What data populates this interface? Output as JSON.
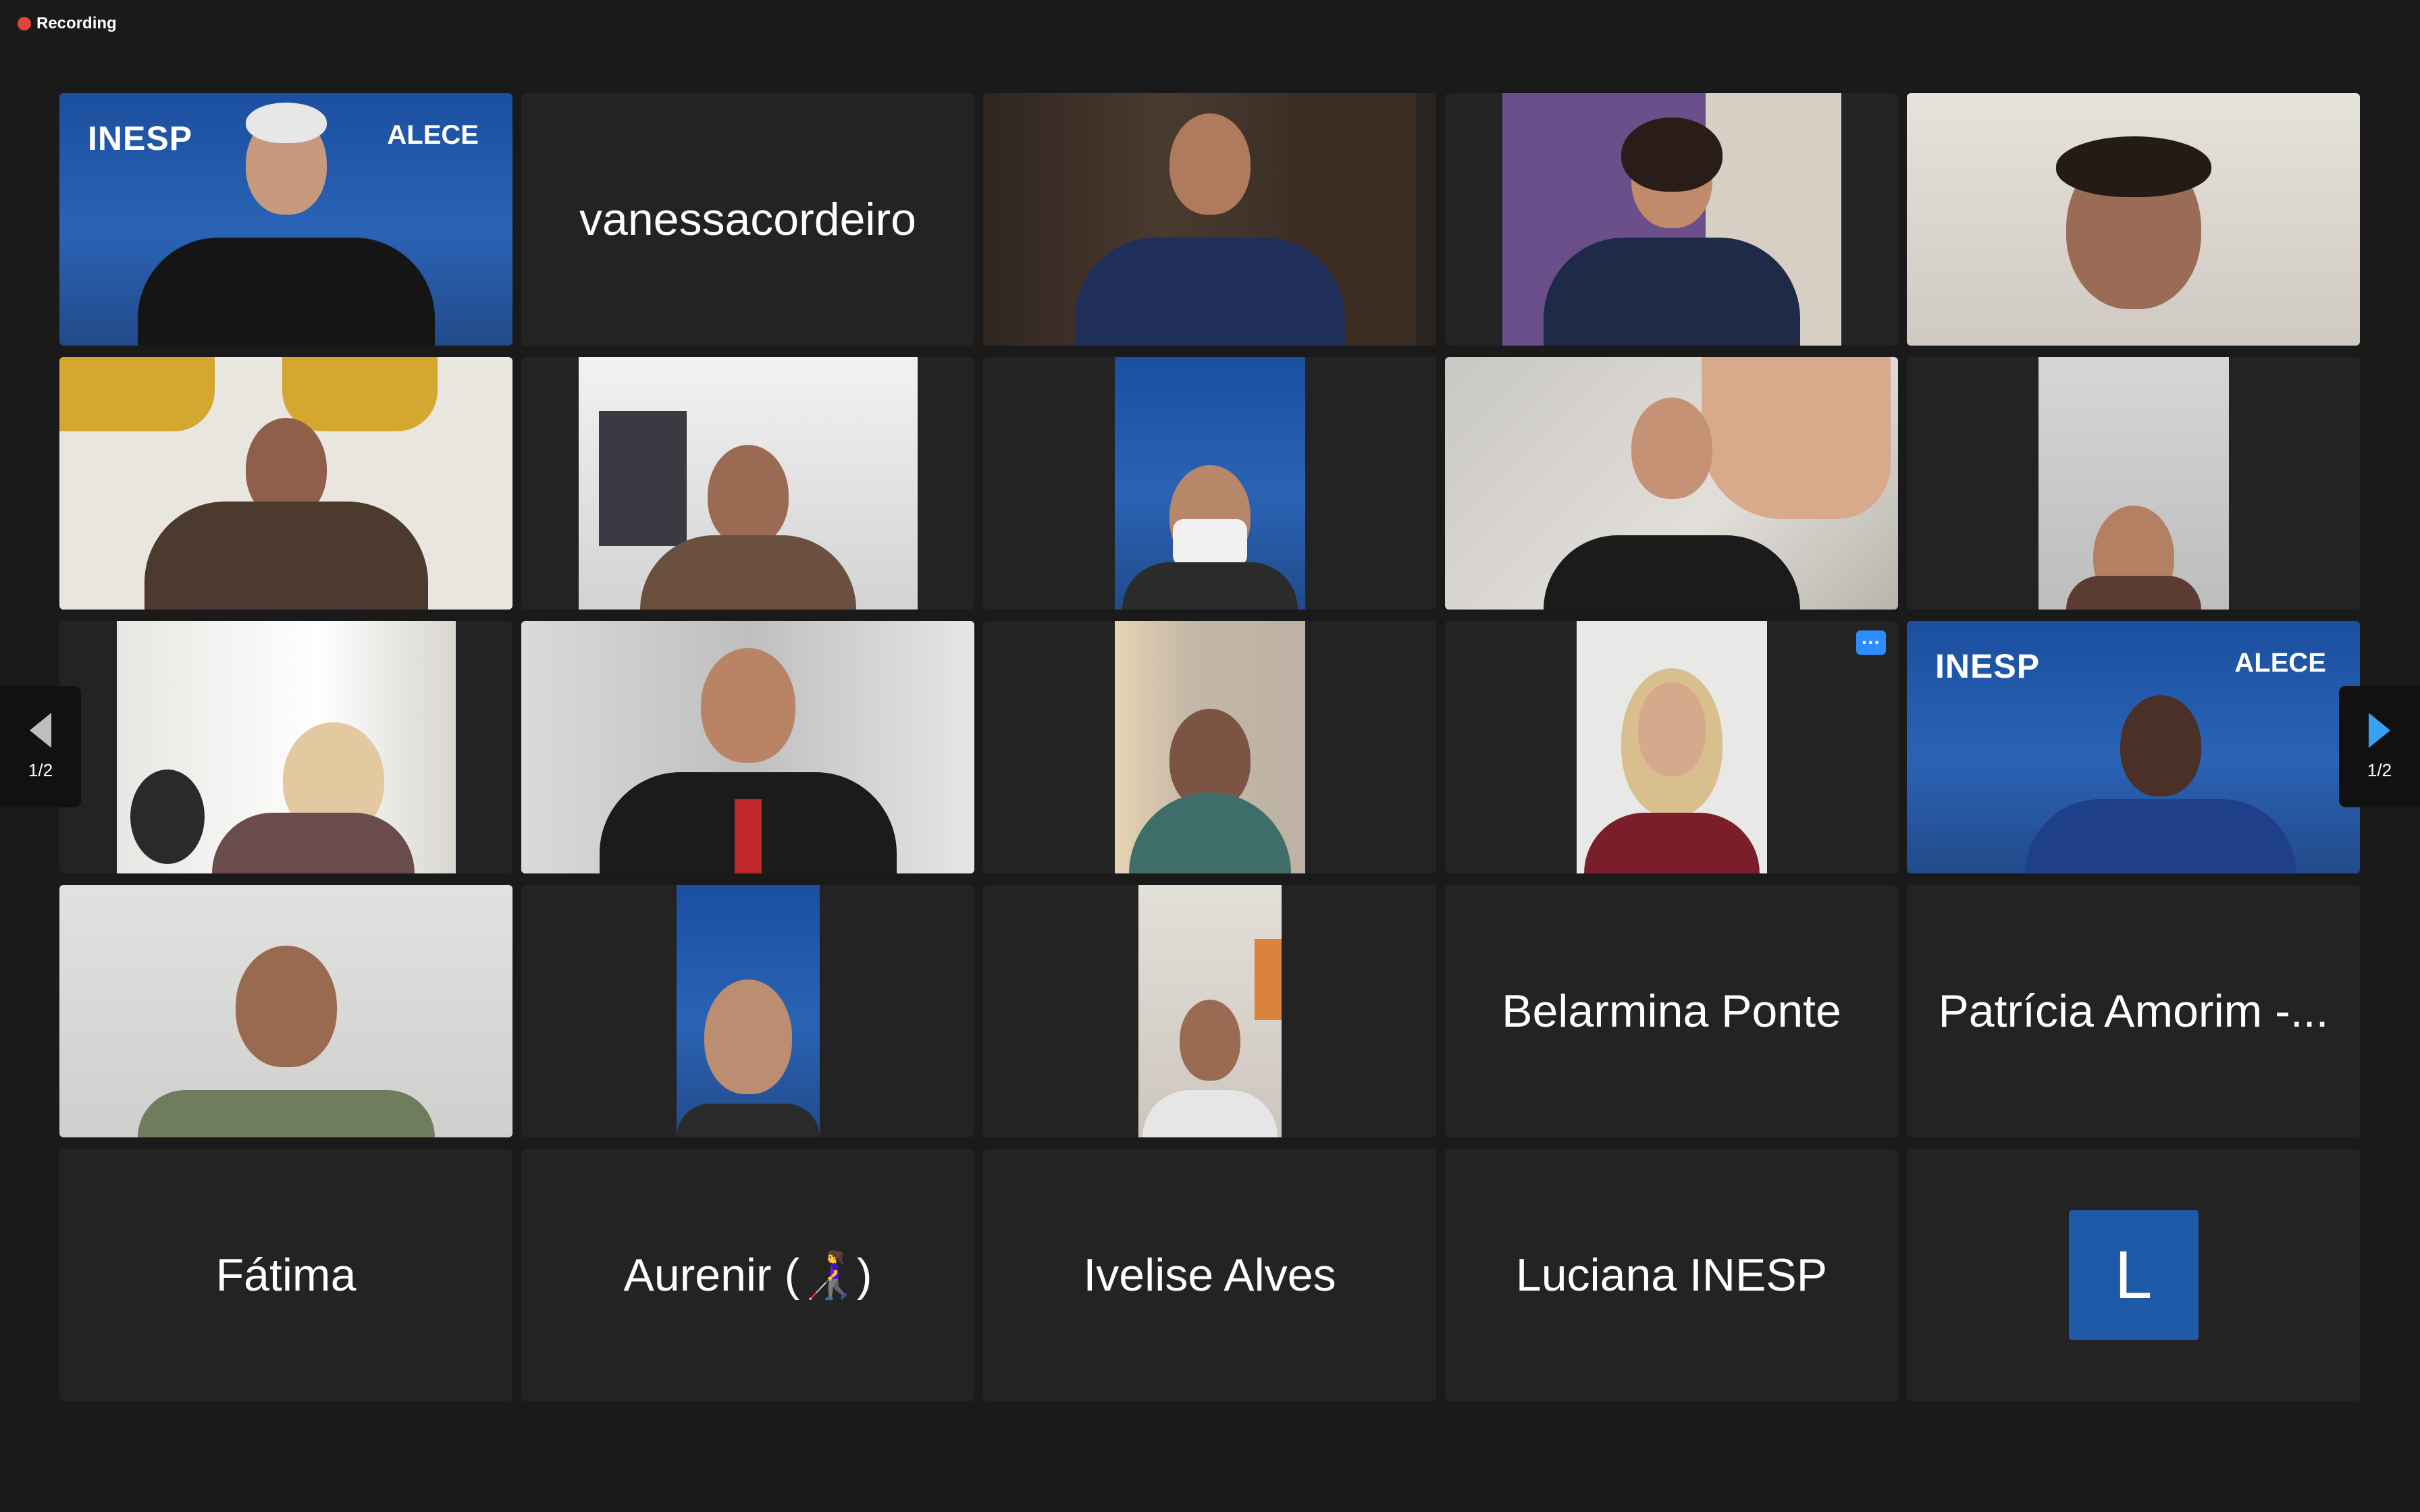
{
  "recording": {
    "label": "Recording"
  },
  "branding": {
    "inesp": "INESP",
    "alece": "ALECE"
  },
  "tiles": {
    "t2": {
      "name": "vanessacordeiro"
    },
    "t19": {
      "name": "Belarmina Ponte"
    },
    "t20": {
      "name": "Patrícia Amorim -..."
    },
    "t21": {
      "name": "Fátima"
    },
    "t22": {
      "name": "Aurenir (👩‍🦯)"
    },
    "t23": {
      "name": "Ivelise Alves"
    },
    "t24": {
      "name": "Luciana INESP"
    },
    "t25": {
      "avatar_letter": "L"
    }
  },
  "pagination": {
    "left_label": "1/2",
    "right_label": "1/2"
  },
  "more_options": {
    "label": "···"
  },
  "colors": {
    "active_speaker": "#4bc455",
    "recording": "#e5443b",
    "avatar": "#1f5aa8",
    "nav_arrow": "#3aa0f2"
  }
}
